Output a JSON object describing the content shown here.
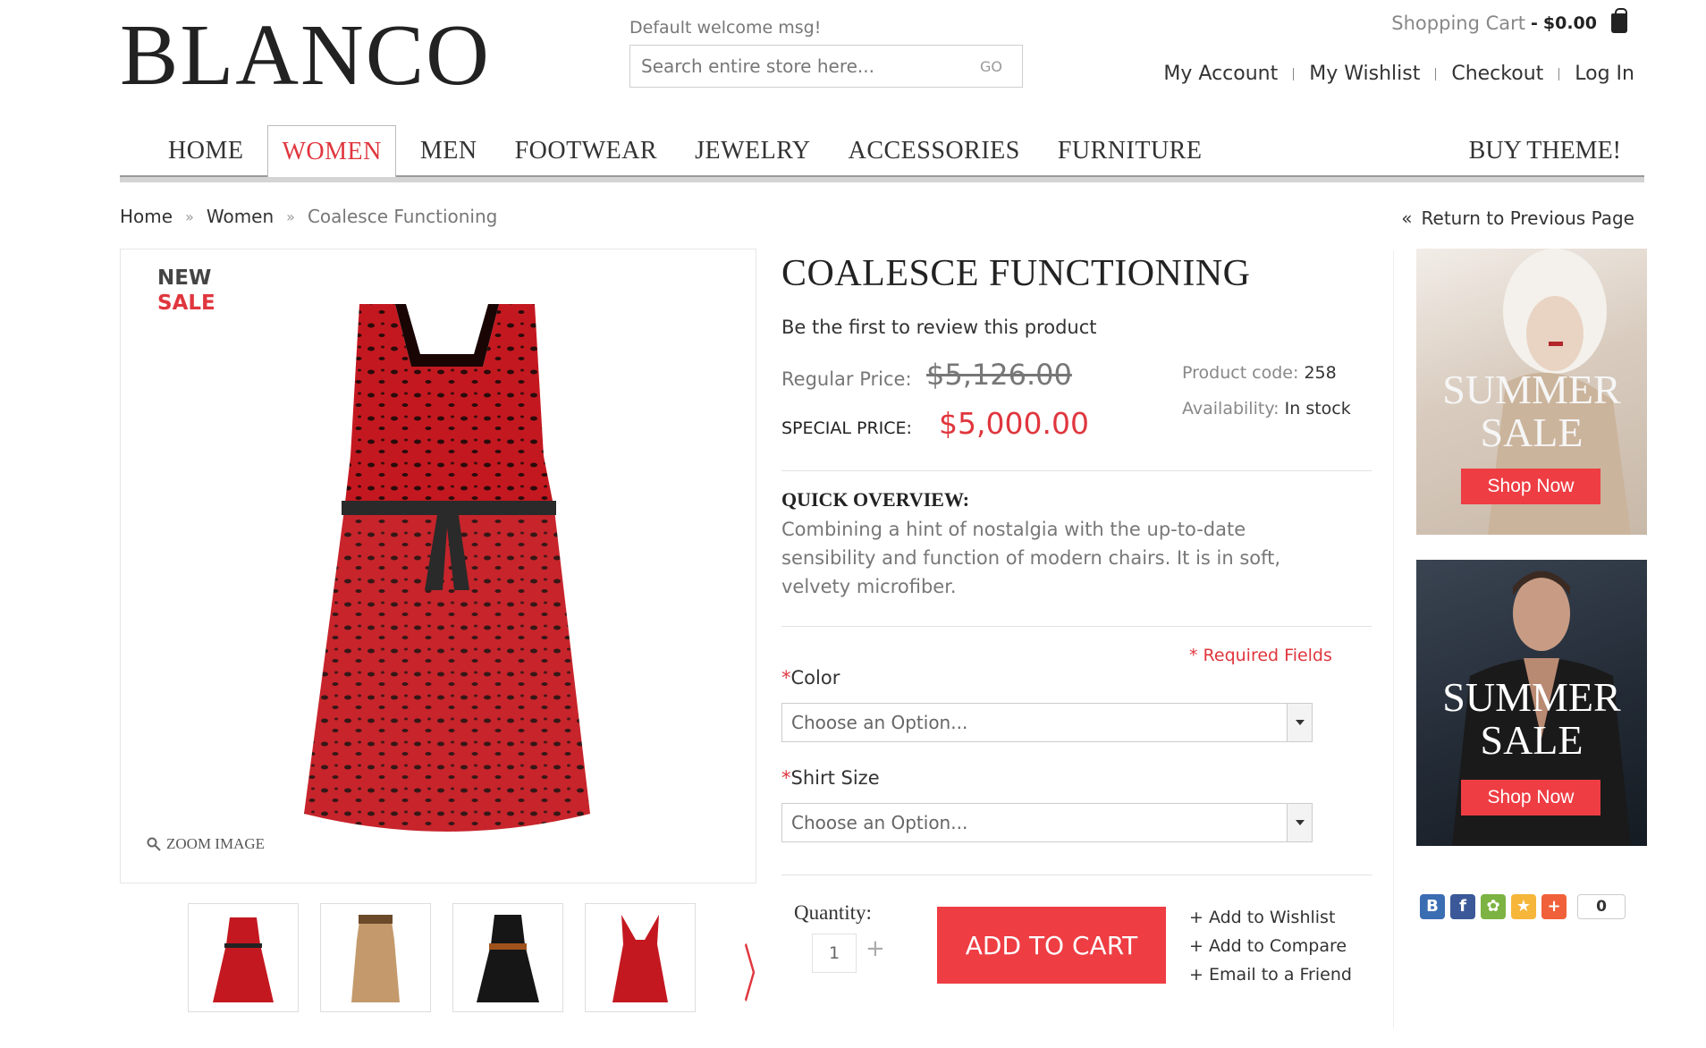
{
  "header": {
    "logo": "BLANCO",
    "welcome": "Default welcome msg!",
    "search_placeholder": "Search entire store here...",
    "search_button": "GO",
    "cart_label": "Shopping Cart",
    "cart_separator": "-",
    "cart_total": "$0.00",
    "links": [
      "My Account",
      "My Wishlist",
      "Checkout",
      "Log In"
    ]
  },
  "nav": {
    "items": [
      "HOME",
      "WOMEN",
      "MEN",
      "FOOTWEAR",
      "JEWELRY",
      "ACCESSORIES",
      "FURNITURE"
    ],
    "active": "WOMEN",
    "buy_theme": "BUY THEME!"
  },
  "breadcrumb": {
    "items": [
      "Home",
      "Women",
      "Coalesce Functioning"
    ],
    "separator": "»",
    "return_icon": "«",
    "return_label": "Return to Previous Page"
  },
  "product": {
    "badge_new": "NEW",
    "badge_sale": "SALE",
    "zoom_label": "ZOOM IMAGE",
    "title": "COALESCE FUNCTIONING",
    "review_text": "Be the first to review this product",
    "regular_price_label": "Regular Price:",
    "regular_price": "$5,126.00",
    "special_price_label": "SPECIAL PRICE:",
    "special_price": "$5,000.00",
    "product_code_label": "Product code:",
    "product_code": "258",
    "availability_label": "Availability:",
    "availability": "In stock",
    "overview_title": "QUICK OVERVIEW:",
    "overview_text": "Combining a hint of nostalgia with the up-to-date sensibility and function of modern chairs. It is in soft, velvety microfiber.",
    "required_fields": "* Required Fields",
    "color_label": "Color",
    "color_value": "Choose an Option...",
    "size_label": "Shirt Size",
    "size_value": "Choose an Option...",
    "quantity_label": "Quantity:",
    "quantity": "1",
    "add_to_cart": "ADD TO CART",
    "add_to_wishlist": "+ Add to Wishlist",
    "add_to_compare": "+ Add to Compare",
    "email_friend": "+ Email to a Friend"
  },
  "thumbnails": [
    "red-leopard-dress",
    "tan-dress",
    "black-belted-dress",
    "red-dress"
  ],
  "banners": [
    {
      "line1": "SUMMER",
      "line2": "SALE",
      "button": "Shop Now"
    },
    {
      "line1": "SUMMER",
      "line2": "SALE",
      "button": "Shop Now"
    }
  ],
  "social": {
    "icons": [
      "B",
      "f",
      "✿",
      "★",
      "+"
    ],
    "count": "0"
  },
  "colors": {
    "accent": "#ee3d43",
    "nav_active": "#e0363e"
  }
}
